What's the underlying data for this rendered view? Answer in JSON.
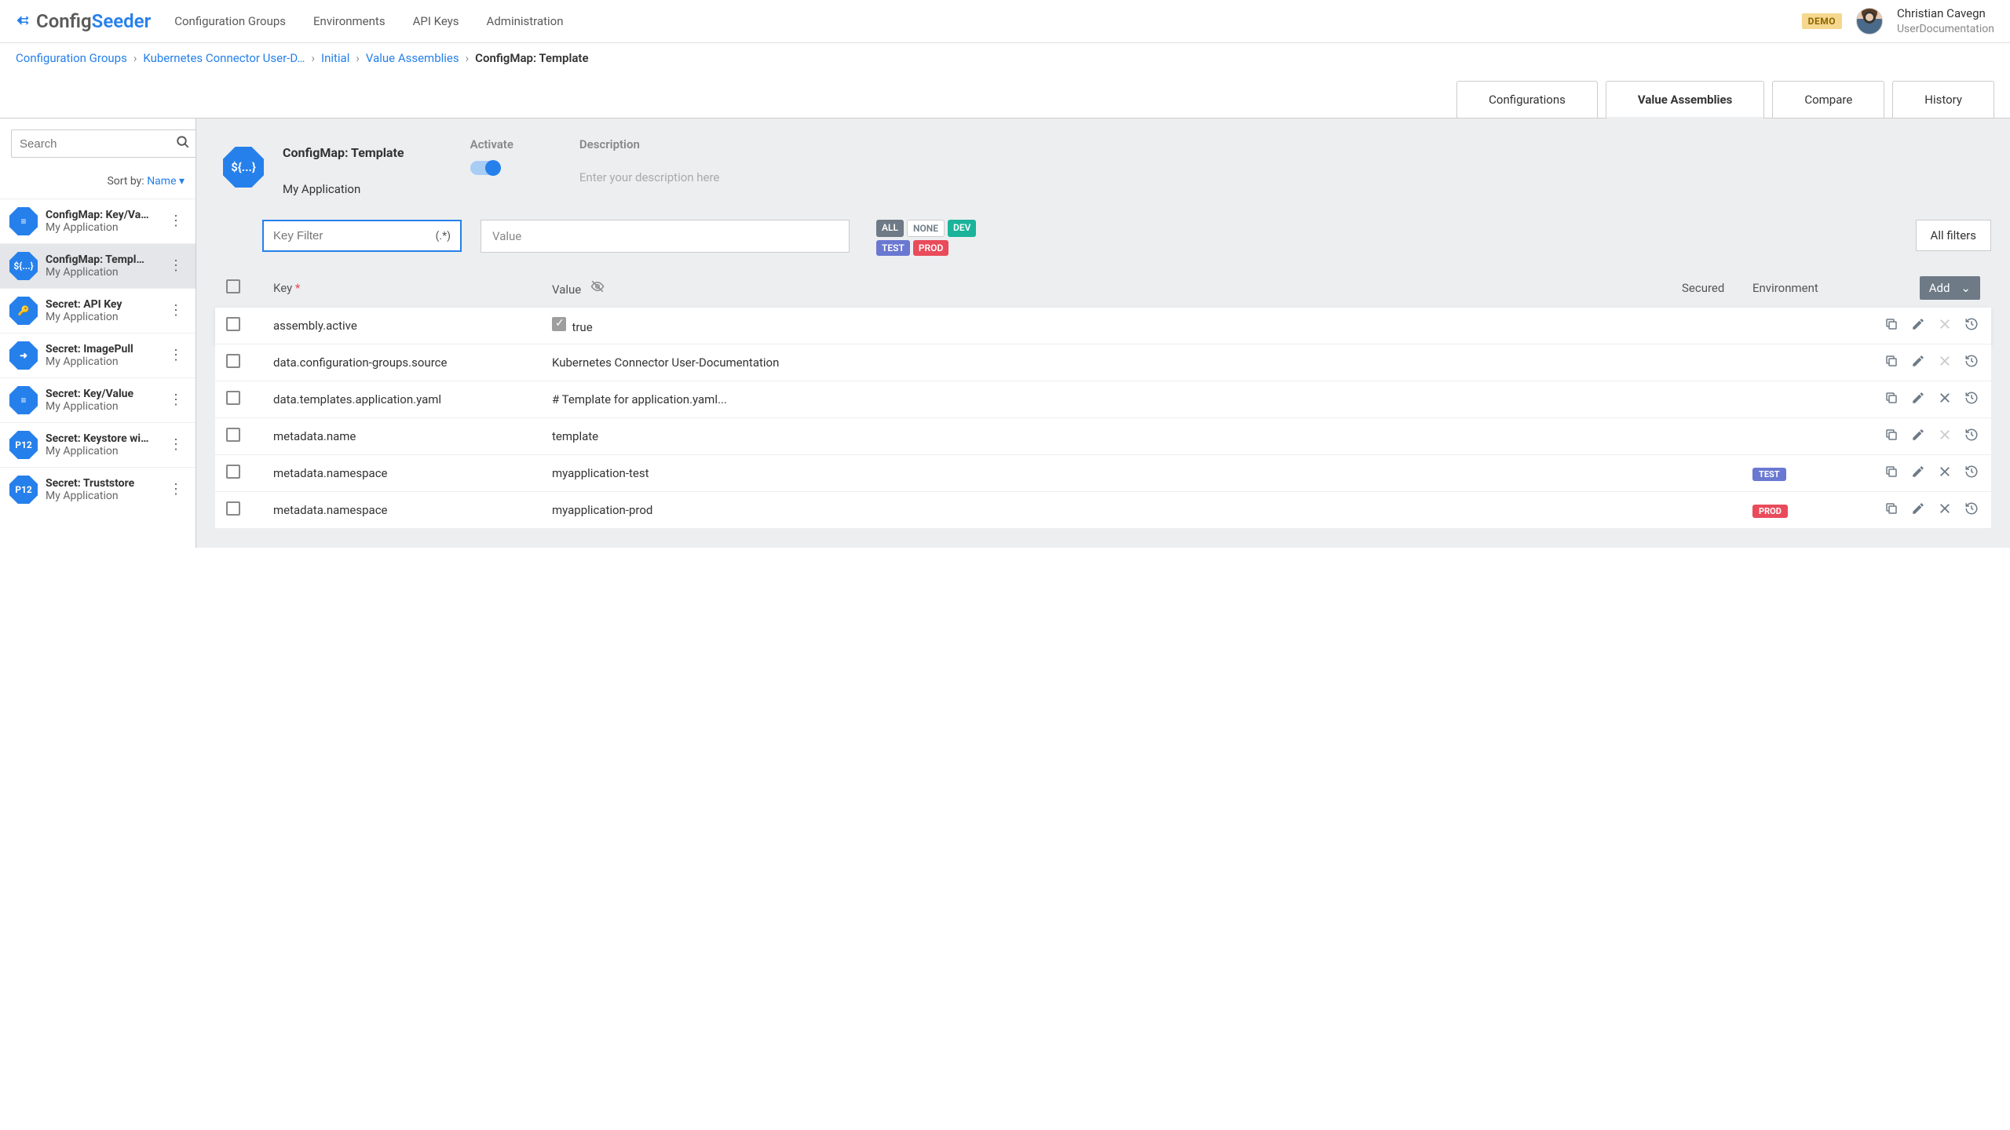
{
  "header": {
    "brand1": "Config",
    "brand2": "Seeder",
    "nav": [
      "Configuration Groups",
      "Environments",
      "API Keys",
      "Administration"
    ],
    "demo": "DEMO",
    "user_name": "Christian Cavegn",
    "user_org": "UserDocumentation"
  },
  "breadcrumb": {
    "items": [
      "Configuration Groups",
      "Kubernetes Connector User-D…",
      "Initial",
      "Value Assemblies"
    ],
    "current": "ConfigMap: Template"
  },
  "tabs": [
    "Configurations",
    "Value Assemblies",
    "Compare",
    "History"
  ],
  "active_tab": 1,
  "sidebar": {
    "search_placeholder": "Search",
    "sort_label": "Sort by:",
    "sort_value": "Name",
    "items": [
      {
        "icon": "≡",
        "title": "ConfigMap: Key/Va…",
        "sub": "My Application"
      },
      {
        "icon": "${...}",
        "title": "ConfigMap: Templ…",
        "sub": "My Application",
        "active": true
      },
      {
        "icon": "🔑",
        "title": "Secret: API Key",
        "sub": "My Application"
      },
      {
        "icon": "➜",
        "title": "Secret: ImagePull",
        "sub": "My Application"
      },
      {
        "icon": "≡",
        "title": "Secret: Key/Value",
        "sub": "My Application"
      },
      {
        "icon": "P12",
        "title": "Secret: Keystore wi…",
        "sub": "My Application"
      },
      {
        "icon": "P12",
        "title": "Secret: Truststore",
        "sub": "My Application"
      }
    ]
  },
  "detail": {
    "icon": "${...}",
    "title": "ConfigMap: Template",
    "sub": "My Application",
    "activate_label": "Activate",
    "desc_label": "Description",
    "desc_placeholder": "Enter your description here"
  },
  "filters": {
    "key_placeholder": "Key Filter",
    "regex": "(.*)",
    "value_placeholder": "Value",
    "chips": {
      "all": "ALL",
      "none": "NONE",
      "dev": "DEV",
      "test": "TEST",
      "prod": "PROD"
    },
    "all_filters": "All filters"
  },
  "table": {
    "headers": {
      "key": "Key",
      "value": "Value",
      "secured": "Secured",
      "env": "Environment",
      "add": "Add"
    },
    "rows": [
      {
        "key": "assembly.active",
        "value": "true",
        "checked_value": true,
        "env": "",
        "delete_disabled": true
      },
      {
        "key": "data.configuration-groups.source",
        "value": "Kubernetes Connector User-Documentation",
        "env": "",
        "delete_disabled": true
      },
      {
        "key": "data.templates.application.yaml",
        "value": "# Template for application.yaml...",
        "env": "",
        "delete_disabled": false
      },
      {
        "key": "metadata.name",
        "value": "template",
        "env": "",
        "delete_disabled": true
      },
      {
        "key": "metadata.namespace",
        "value": "myapplication-test",
        "env": "TEST",
        "delete_disabled": false
      },
      {
        "key": "metadata.namespace",
        "value": "myapplication-prod",
        "env": "PROD",
        "delete_disabled": false
      }
    ]
  }
}
